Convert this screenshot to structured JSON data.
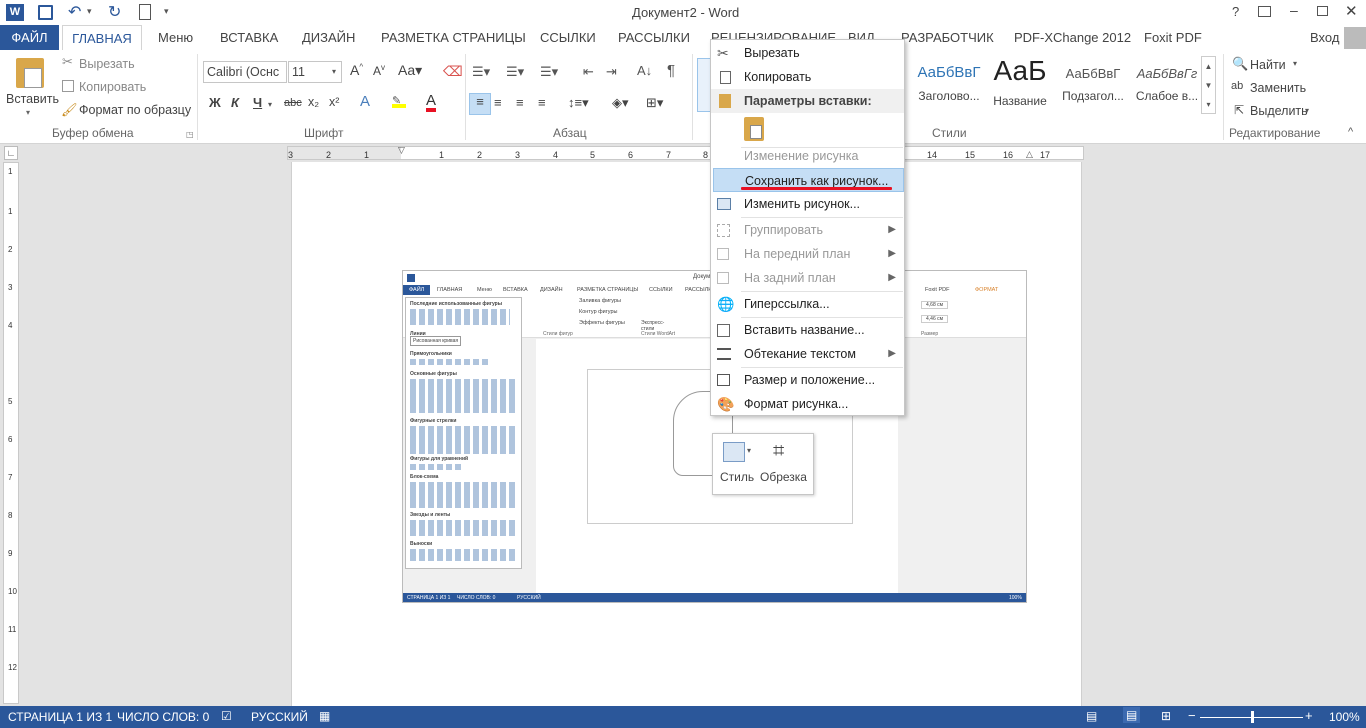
{
  "window": {
    "title": "Документ2 - Word",
    "help": "?",
    "login": "Вход",
    "quick_access": [
      "save-icon",
      "undo-icon",
      "redo-icon",
      "new-doc-icon"
    ]
  },
  "tabs": [
    "ФАЙЛ",
    "ГЛАВНАЯ",
    "Меню",
    "ВСТАВКА",
    "ДИЗАЙН",
    "РАЗМЕТКА СТРАНИЦЫ",
    "ССЫЛКИ",
    "РАССЫЛКИ",
    "РЕЦЕНЗИРОВАНИЕ",
    "ВИД",
    "РАЗРАБОТЧИК",
    "PDF-XChange 2012",
    "Foxit PDF"
  ],
  "ribbon": {
    "clipboard": {
      "paste": "Вставить",
      "cut": "Вырезать",
      "copy": "Копировать",
      "format_painter": "Формат по образцу",
      "label": "Буфер обмена"
    },
    "font": {
      "name": "Calibri (Оснс",
      "size": "11",
      "bold": "Ж",
      "italic": "К",
      "underline": "Ч",
      "strike": "abc",
      "sub": "x₂",
      "sup": "x²",
      "label": "Шрифт"
    },
    "paragraph": {
      "label": "Абзац"
    },
    "styles": {
      "items": [
        {
          "preview": "АаБбВвГ",
          "name": "Заголово..."
        },
        {
          "preview": "АаБ",
          "name": "Название"
        },
        {
          "preview": "АаБбВвГ",
          "name": "Подзагол..."
        },
        {
          "preview": "АаБбВвГг",
          "name": "Слабое в..."
        }
      ],
      "label": "Стили"
    },
    "editing": {
      "find": "Найти",
      "replace": "Заменить",
      "select": "Выделить",
      "label": "Редактирование"
    }
  },
  "ruler_h": [
    "3",
    "2",
    "1",
    "1",
    "2",
    "3",
    "4",
    "5",
    "6",
    "7",
    "8",
    "14",
    "15",
    "16",
    "17"
  ],
  "ruler_v": [
    "1",
    "1",
    "2",
    "3",
    "4",
    "5",
    "6",
    "7",
    "8",
    "9",
    "10",
    "11",
    "12"
  ],
  "context_menu": {
    "cut": "Вырезать",
    "copy": "Копировать",
    "paste_header": "Параметры вставки:",
    "change_picture_disabled": "Изменение рисунка",
    "save_as_picture": "Сохранить как рисунок...",
    "change_picture": "Изменить рисунок...",
    "group": "Группировать",
    "bring_forward": "На передний план",
    "send_backward": "На задний план",
    "hyperlink": "Гиперссылка...",
    "insert_caption": "Вставить название...",
    "wrap_text": "Обтекание текстом",
    "size_position": "Размер и положение...",
    "format_picture": "Формат рисунка..."
  },
  "mini_toolbar": {
    "style": "Стиль",
    "crop": "Обрезка"
  },
  "embedded_screenshot": {
    "tabs": [
      "ФАЙЛ",
      "ГЛАВНАЯ",
      "Меню",
      "ВСТАВКА",
      "ДИЗАЙН",
      "РАЗМЕТКА СТРАНИЦЫ",
      "ССЫЛКИ",
      "РАССЫЛКИ",
      "Foxit PDF",
      "ФОРМАТ"
    ],
    "title": "Докуме",
    "shape_sections": [
      "Последние использованные фигуры",
      "Линии",
      "Прямоугольники",
      "Основные фигуры",
      "Фигурные стрелки",
      "Фигуры для уравнений",
      "Блок-схема",
      "Звезды и ленты",
      "Выноски"
    ],
    "tooltip": "Рисованная кривая",
    "fill": "Заливка фигуры",
    "outline": "Контур фигуры",
    "effects": "Эффекты фигуры",
    "express": "Экспресс-стили",
    "styles_label": "Стили фигур",
    "wordart_label": "Стили WordArt",
    "size_label": "Размер",
    "h": "4,68 см",
    "w": "4,46 см",
    "status": [
      "СТРАНИЦА 1 ИЗ 1",
      "ЧИСЛО СЛОВ: 0",
      "РУССКИЙ"
    ],
    "zoom": "100%"
  },
  "statusbar": {
    "page": "СТРАНИЦА 1 ИЗ 1",
    "words": "ЧИСЛО СЛОВ: 0",
    "lang": "РУССКИЙ",
    "zoom": "100%"
  },
  "colors": {
    "accent": "#2b579a",
    "highlight": "#c5def5",
    "red_underline": "#e81123"
  }
}
